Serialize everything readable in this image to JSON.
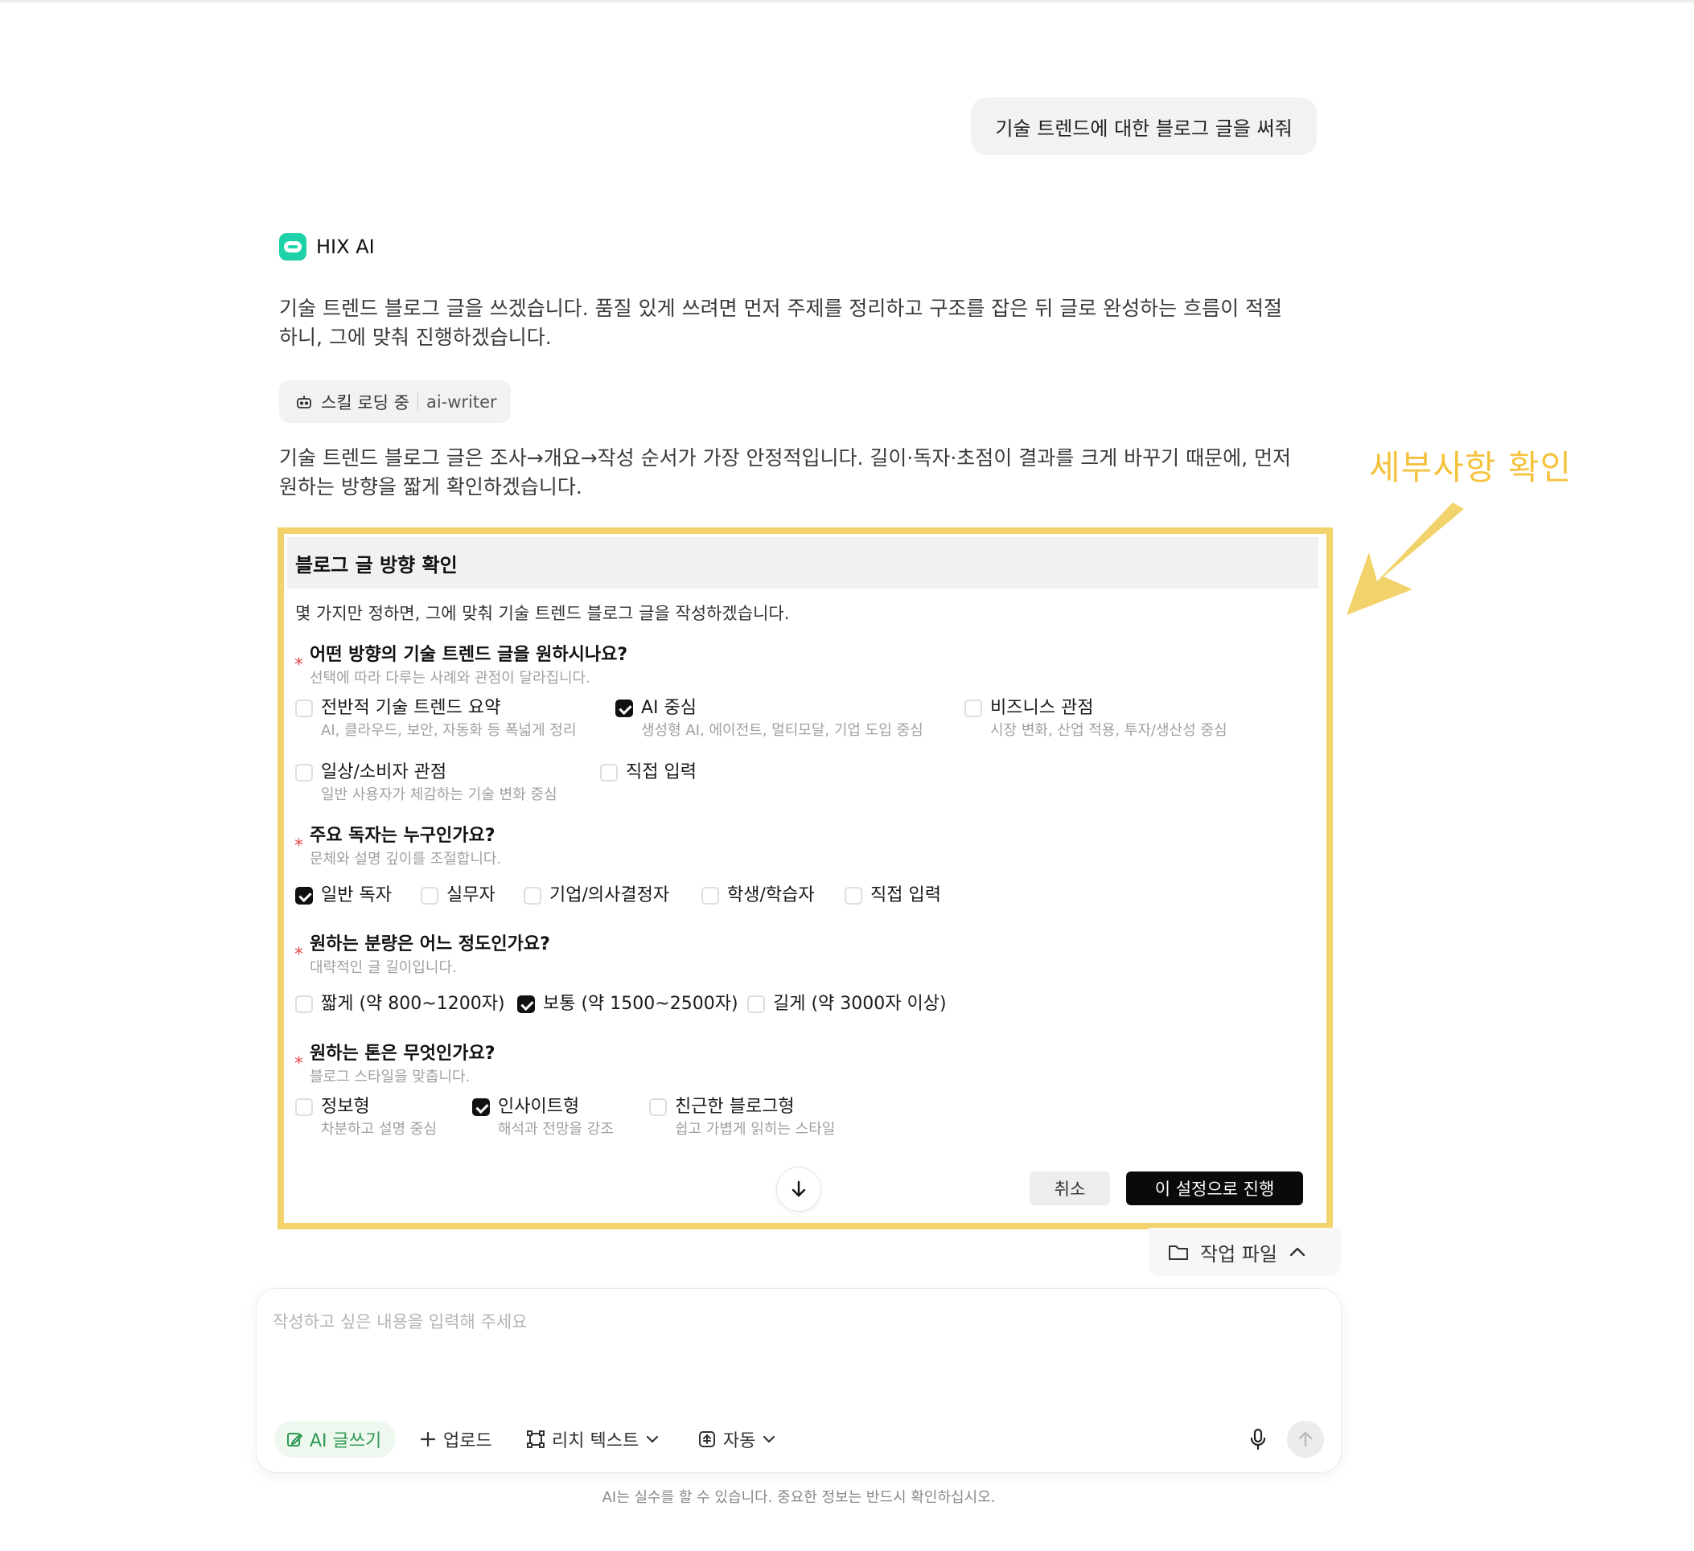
{
  "user_message": "기술 트렌드에 대한 블로그 글을 써줘",
  "assistant": {
    "name": "HIX AI",
    "intro_lines": [
      "기술 트렌드 블로그 글을 쓰겠습니다. 품질 있게 쓰려면 먼저 주제를 정리하고 구조를 잡은 뒤 글로 완성하는 흐름이 적절",
      "하니, 그에 맞춰 진행하겠습니다."
    ],
    "skill_status": "스킬 로딩 중",
    "skill_name": "ai-writer",
    "followup_lines": [
      "기술 트렌드 블로그 글은 조사→개요→작성 순서가 가장 안정적입니다. 길이·독자·초점이 결과를 크게 바꾸기 때문에, 먼저",
      "원하는 방향을 짧게 확인하겠습니다."
    ]
  },
  "annotation": {
    "label": "세부사항 확인",
    "color": "#f5c23e"
  },
  "form": {
    "title": "블로그 글 방향 확인",
    "intro": "몇 가지만 정하면, 그에 맞춰 기술 트렌드 블로그 글을 작성하겠습니다.",
    "questions": [
      {
        "title": "어떤 방향의 기술 트렌드 글을 원하시나요?",
        "subtitle": "선택에 따라 다루는 사례와 관점이 달라집니다.",
        "options": [
          {
            "label": "전반적 기술 트렌드 요약",
            "desc": "AI, 클라우드, 보안, 자동화 등 폭넓게 정리",
            "checked": false
          },
          {
            "label": "AI 중심",
            "desc": "생성형 AI, 에이전트, 멀티모달, 기업 도입 중심",
            "checked": true
          },
          {
            "label": "비즈니스 관점",
            "desc": "시장 변화, 산업 적용, 투자/생산성 중심",
            "checked": false
          },
          {
            "label": "일상/소비자 관점",
            "desc": "일반 사용자가 체감하는 기술 변화 중심",
            "checked": false
          },
          {
            "label": "직접 입력",
            "desc": "",
            "checked": false
          }
        ]
      },
      {
        "title": "주요 독자는 누구인가요?",
        "subtitle": "문체와 설명 깊이를 조절합니다.",
        "options": [
          {
            "label": "일반 독자",
            "checked": true
          },
          {
            "label": "실무자",
            "checked": false
          },
          {
            "label": "기업/의사결정자",
            "checked": false
          },
          {
            "label": "학생/학습자",
            "checked": false
          },
          {
            "label": "직접 입력",
            "checked": false
          }
        ]
      },
      {
        "title": "원하는 분량은 어느 정도인가요?",
        "subtitle": "대략적인 글 길이입니다.",
        "options": [
          {
            "label": "짧게 (약 800~1200자)",
            "checked": false
          },
          {
            "label": "보통 (약 1500~2500자)",
            "checked": true
          },
          {
            "label": "길게 (약 3000자 이상)",
            "checked": false
          }
        ]
      },
      {
        "title": "원하는 톤은 무엇인가요?",
        "subtitle": "블로그 스타일을 맞춥니다.",
        "options": [
          {
            "label": "정보형",
            "desc": "차분하고 설명 중심",
            "checked": false
          },
          {
            "label": "인사이트형",
            "desc": "해석과 전망을 강조",
            "checked": true
          },
          {
            "label": "친근한 블로그형",
            "desc": "쉽고 가볍게 읽히는 스타일",
            "checked": false
          }
        ]
      }
    ],
    "cancel_label": "취소",
    "proceed_label": "이 설정으로 진행"
  },
  "work_files_label": "작업 파일",
  "composer": {
    "placeholder": "작성하고 싶은 내용을 입력해 주세요",
    "tools": {
      "ai_write": "AI 글쓰기",
      "upload": "업로드",
      "rich_text": "리치 텍스트",
      "auto": "자동"
    }
  },
  "disclaimer": "AI는 실수를 할 수 있습니다. 중요한 정보는 반드시 확인하십시오."
}
